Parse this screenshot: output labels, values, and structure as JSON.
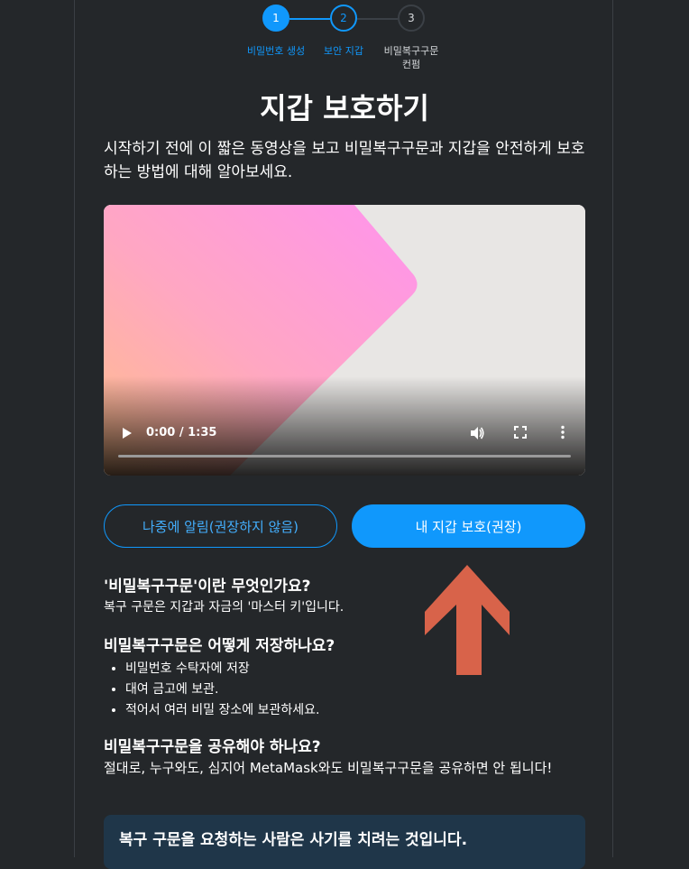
{
  "stepper": {
    "steps": [
      {
        "number": "1",
        "label": "비밀번호 생성"
      },
      {
        "number": "2",
        "label": "보안 지갑"
      },
      {
        "number": "3",
        "label": "비밀복구구문\n컨펌"
      }
    ]
  },
  "page": {
    "title": "지갑 보호하기",
    "intro": "시작하기 전에 이 짧은 동영상을 보고 비밀복구구문과 지갑을 안전하게 보호하는 방법에 대해 알아보세요."
  },
  "video": {
    "time": "0:00 / 1:35",
    "progress": 0
  },
  "buttons": {
    "remind_later": "나중에 알림(권장하지 않음)",
    "secure_wallet": "내 지갑 보호(권장)"
  },
  "faq": {
    "q1_title": "'비밀복구구문'이란 무엇인가요?",
    "q1_text": "복구 구문은 지갑과 자금의 '마스터 키'입니다.",
    "q2_title": "비밀복구구문은 어떻게 저장하나요?",
    "q2_items": [
      "비밀번호 수탁자에 저장",
      "대여 금고에 보관.",
      "적어서 여러 비밀 장소에 보관하세요."
    ],
    "q3_title": "비밀복구구문을 공유해야 하나요?",
    "q3_text": "절대로, 누구와도, 심지어 MetaMask와도 비밀복구구문을 공유하면 안 됩니다!"
  },
  "warning": {
    "text": "복구 구문을 요청하는 사람은 사기를 치려는 것입니다."
  },
  "colors": {
    "background": "#24272a",
    "accent": "#1098fc",
    "arrow": "#d8634a",
    "warning_bg": "#1f3649"
  },
  "icons": [
    "play-icon",
    "volume-icon",
    "fullscreen-icon",
    "more-vertical-icon",
    "up-arrow-icon"
  ]
}
